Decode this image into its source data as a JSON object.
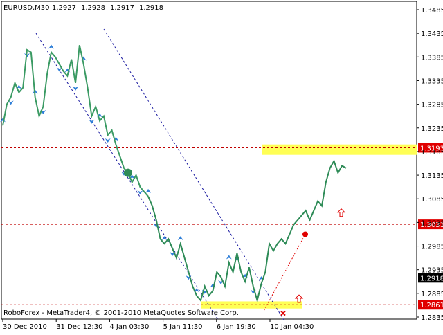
{
  "header": {
    "symbol_line": "EURUSD,M30",
    "ohlc": [
      "1.2927",
      "1.2928",
      "1.2917",
      "1.2918"
    ]
  },
  "footer": {
    "copyright": "RoboForex - MetaTrader4, © 2001-2010 MetaQuotes Software Corp."
  },
  "colors": {
    "price": "#2e8b57",
    "past_price": "#3a9a63",
    "arrows": "#2f7fd8",
    "channel": "#1a1aa0",
    "level_line": "#c00000",
    "level_label_bg": "#e00000",
    "zone": "#ffff55",
    "current_label_bg": "#000000",
    "forecast": "#e00000"
  },
  "chart_data": {
    "type": "line",
    "title": "EURUSD,M30",
    "ylim": [
      1.2835,
      1.3485
    ],
    "y_ticks": [
      "1.3485",
      "1.3435",
      "1.3385",
      "1.3335",
      "1.3285",
      "1.3235",
      "1.3185",
      "1.3135",
      "1.3085",
      "1.3035",
      "1.2985",
      "1.2935",
      "1.2885",
      "1.2835"
    ],
    "x_ticks": [
      "30 Dec 2010",
      "31 Dec 12:30",
      "4 Jan 03:30",
      "5 Jan 11:30",
      "6 Jan 19:30",
      "10 Jan 04:30"
    ],
    "levels": [
      {
        "label": "1.3193",
        "value": 1.3193
      },
      {
        "label": "1.3031",
        "value": 1.3031
      },
      {
        "label": "1.2861",
        "value": 1.2861
      }
    ],
    "current_price": {
      "label": "1.2918",
      "value": 1.2918
    },
    "zones": [
      {
        "low": 1.3178,
        "high": 1.32
      },
      {
        "low": 1.2853,
        "high": 1.2868
      }
    ],
    "price_series": {
      "name": "",
      "values": [
        1.324,
        1.3285,
        1.33,
        1.333,
        1.331,
        1.332,
        1.34,
        1.3395,
        1.33,
        1.326,
        1.328,
        1.335,
        1.3395,
        1.3385,
        1.337,
        1.3355,
        1.3345,
        1.338,
        1.333,
        1.341,
        1.337,
        1.332,
        1.326,
        1.328,
        1.325,
        1.326,
        1.322,
        1.323,
        1.32,
        1.3175,
        1.315,
        1.314,
        1.312,
        1.3135,
        1.311,
        1.31,
        1.309,
        1.307,
        1.304,
        1.3,
        1.299,
        1.3,
        1.298,
        1.296,
        1.299,
        1.296,
        1.293,
        1.29,
        1.288,
        1.287,
        1.29,
        1.288,
        1.289,
        1.293,
        1.292,
        1.29,
        1.295,
        1.293,
        1.297,
        1.293,
        1.291,
        1.294,
        1.29,
        1.287,
        1.2905,
        1.293,
        1.299,
        1.2975,
        1.299,
        1.3,
        1.299,
        1.301,
        1.303,
        1.304,
        1.305,
        1.306,
        1.304,
        1.306,
        1.308,
        1.307,
        1.312,
        1.315,
        1.3165,
        1.314,
        1.3155,
        1.315
      ]
    },
    "forecast_arrows": [
      {
        "label": "up",
        "at_value": 1.2873
      },
      {
        "label": "up",
        "at_value": 1.3055
      }
    ],
    "forecast_cross": {
      "at_value": 1.2843
    },
    "annotations": [
      {
        "text": "1.3193"
      },
      {
        "text": "1.3031"
      },
      {
        "text": "1.2861"
      },
      {
        "text": "1.2918"
      }
    ]
  }
}
